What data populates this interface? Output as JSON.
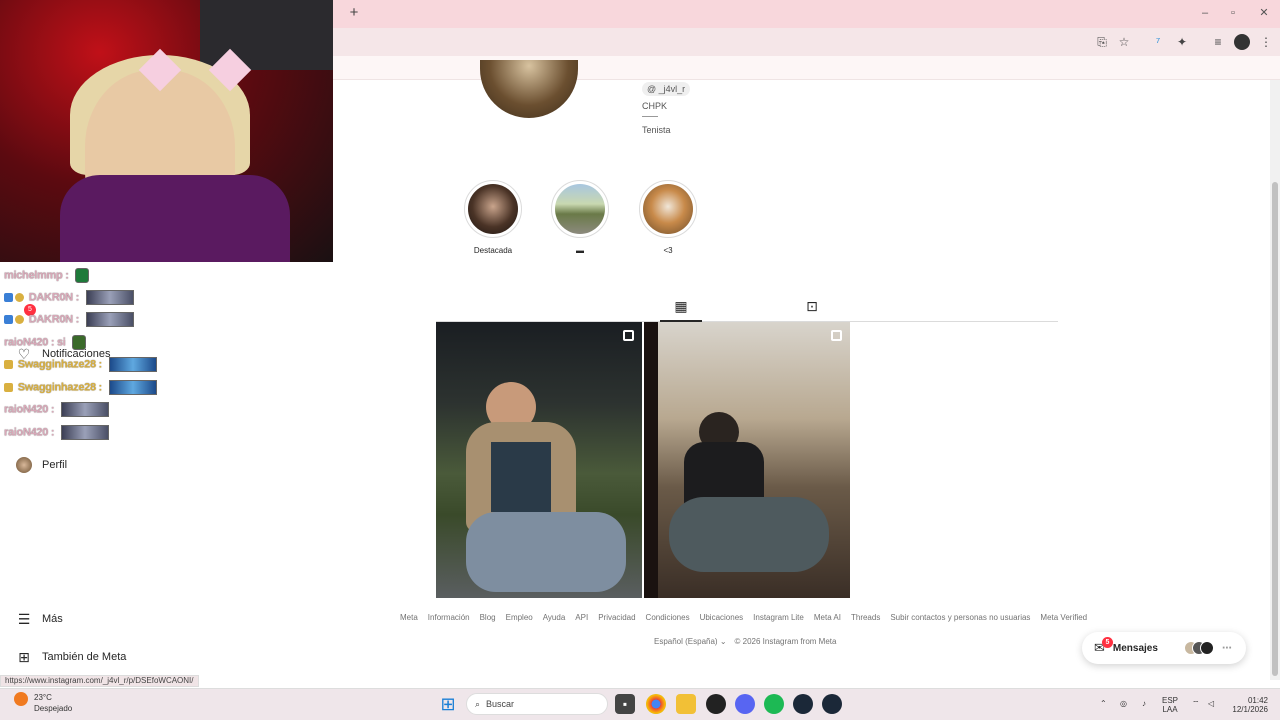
{
  "browser": {
    "new_tab_glyph": "+",
    "window_controls": [
      "–",
      "▫",
      "✕"
    ],
    "status_url": "https://www.instagram.com/_j4vl_r/p/DSEfoWCAONI/"
  },
  "chat": [
    {
      "user": "michelmmp",
      "suffix": " :"
    },
    {
      "user": "DAKR0N",
      "suffix": " :"
    },
    {
      "user": "DAKR0N",
      "suffix": " :"
    },
    {
      "user": "raioN420",
      "suffix": " : si"
    },
    {
      "user": "Swagginhaze28",
      "suffix": " :"
    },
    {
      "user": "Swagginhaze28",
      "suffix": " :"
    },
    {
      "user": "raioN420",
      "suffix": " :"
    },
    {
      "user": "raioN420",
      "suffix": " :"
    }
  ],
  "sidebar": {
    "notifications_label": "Notificaciones",
    "notifications_badge": "5",
    "profile_label": "Perfil",
    "more_label": "Más",
    "meta_label": "También de Meta"
  },
  "profile": {
    "threads_handle": "_j4vl_r",
    "bio_line1": "CHPK",
    "bio_line2": "Tenista",
    "highlights": [
      {
        "label": "Destacada"
      },
      {
        "label": "▬"
      },
      {
        "label": "<3"
      }
    ]
  },
  "footer": {
    "links": [
      "Meta",
      "Información",
      "Blog",
      "Empleo",
      "Ayuda",
      "API",
      "Privacidad",
      "Condiciones",
      "Ubicaciones",
      "Instagram Lite",
      "Meta AI",
      "Threads",
      "Subir contactos y personas no usuarias",
      "Meta Verified"
    ],
    "language": "Español (España)",
    "copyright": "© 2026 Instagram from Meta"
  },
  "messages": {
    "label": "Mensajes",
    "badge": "5"
  },
  "taskbar": {
    "weather_temp": "23°C",
    "weather_desc": "Despejado",
    "search_placeholder": "Buscar",
    "lang_top": "ESP",
    "lang_bottom": "LAA",
    "time": "01:42",
    "date": "12/1/2026"
  },
  "colors": {
    "tabbar": "#f8d7dc",
    "accent_badge": "#ff3040"
  }
}
